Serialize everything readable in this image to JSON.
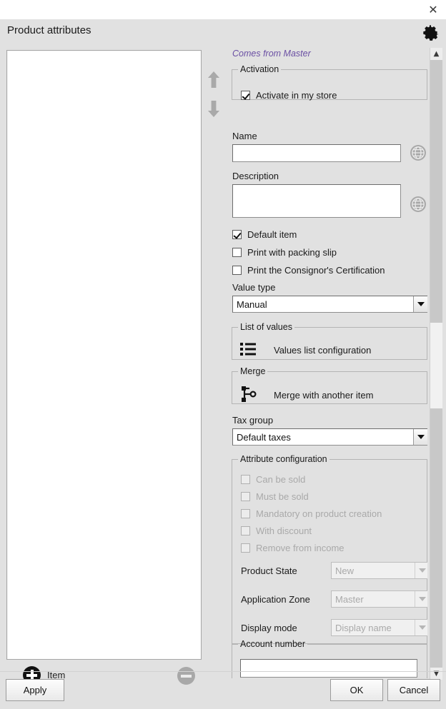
{
  "window": {
    "close_icon": "close-icon",
    "title": "Product attributes",
    "settings_icon": "gear-icon"
  },
  "left_panel": {
    "move_up_icon": "arrow-up-icon",
    "move_down_icon": "arrow-down-icon",
    "add_label": "Item",
    "add_icon": "plus-circle-icon",
    "remove_icon": "minus-circle-icon",
    "list_items": []
  },
  "form": {
    "master_note": "Comes from Master",
    "activation": {
      "legend": "Activation",
      "activate_label": "Activate in my store",
      "activate_checked": true
    },
    "name": {
      "label": "Name",
      "value": "",
      "translate_icon": "globe-icon"
    },
    "description": {
      "label": "Description",
      "value": "",
      "translate_icon": "globe-icon"
    },
    "options": [
      {
        "label": "Default item",
        "checked": true,
        "disabled": false
      },
      {
        "label": "Print with packing slip",
        "checked": false,
        "disabled": false
      },
      {
        "label": "Print the Consignor's Certification",
        "checked": false,
        "disabled": false
      }
    ],
    "value_type": {
      "label": "Value type",
      "value": "Manual"
    },
    "list_of_values": {
      "legend": "List of values",
      "action_label": "Values list configuration",
      "icon": "list-icon"
    },
    "merge": {
      "legend": "Merge",
      "action_label": "Merge with another item",
      "icon": "merge-icon"
    },
    "tax_group": {
      "label": "Tax group",
      "value": "Default taxes"
    },
    "attribute_configuration": {
      "legend": "Attribute configuration",
      "checkboxes": [
        {
          "label": "Can be sold",
          "checked": false,
          "disabled": true
        },
        {
          "label": "Must be sold",
          "checked": false,
          "disabled": true
        },
        {
          "label": "Mandatory on product creation",
          "checked": false,
          "disabled": true
        },
        {
          "label": "With discount",
          "checked": false,
          "disabled": true
        },
        {
          "label": "Remove from income",
          "checked": false,
          "disabled": true
        }
      ],
      "selects": [
        {
          "label": "Product State",
          "value": "New",
          "disabled": true
        },
        {
          "label": "Application Zone",
          "value": "Master",
          "disabled": true
        },
        {
          "label": "Display mode",
          "value": "Display name",
          "disabled": true
        }
      ]
    },
    "account_number": {
      "legend": "Account number",
      "value": ""
    }
  },
  "scrollbar": {
    "up_icon": "chevron-up-icon",
    "down_icon": "chevron-down-icon"
  },
  "footer": {
    "apply_label": "Apply",
    "ok_label": "OK",
    "cancel_label": "Cancel"
  }
}
